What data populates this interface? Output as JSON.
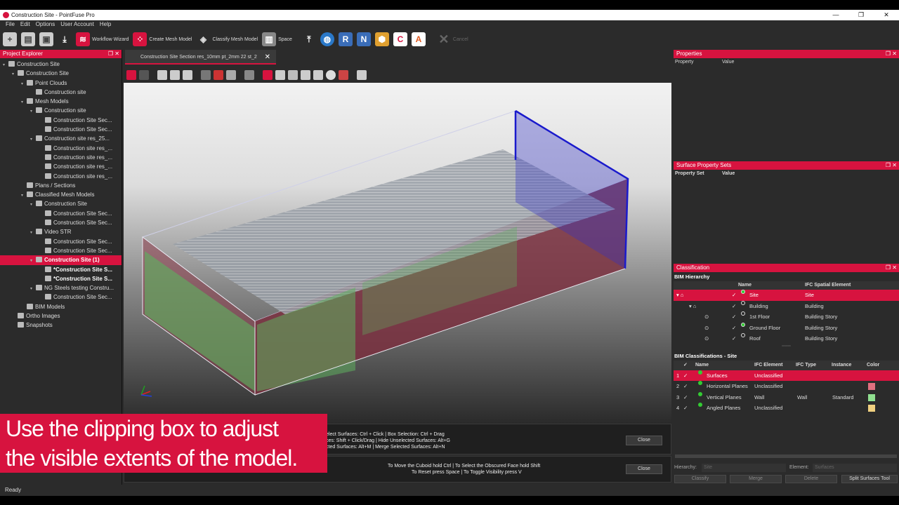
{
  "window": {
    "title": "Construction Site - PointFuse Pro",
    "controls": [
      "—",
      "❐",
      "✕"
    ]
  },
  "menu": [
    "File",
    "Edit",
    "Options",
    "User Account",
    "Help"
  ],
  "toolbar": {
    "workflow_wizard": "Workflow Wizard",
    "create_mesh_model": "Create Mesh Model",
    "classify_mesh_model": "Classify Mesh Model",
    "space": "Space",
    "cancel": "Cancel"
  },
  "explorer": {
    "title": "Project Explorer",
    "items": [
      {
        "label": "Construction Site",
        "depth": 0,
        "arrow": "▾"
      },
      {
        "label": "Construction Site",
        "depth": 1,
        "arrow": "▾"
      },
      {
        "label": "Point Clouds",
        "depth": 2,
        "arrow": "▾"
      },
      {
        "label": "Construction site",
        "depth": 3,
        "arrow": ""
      },
      {
        "label": "Mesh Models",
        "depth": 2,
        "arrow": "▾"
      },
      {
        "label": "Construction site",
        "depth": 3,
        "arrow": "▾"
      },
      {
        "label": "Construction Site Sec...",
        "depth": 4,
        "arrow": ""
      },
      {
        "label": "Construction Site Sec...",
        "depth": 4,
        "arrow": ""
      },
      {
        "label": "Construction site res_25...",
        "depth": 3,
        "arrow": "▾"
      },
      {
        "label": "Construction site res_...",
        "depth": 4,
        "arrow": ""
      },
      {
        "label": "Construction site res_...",
        "depth": 4,
        "arrow": ""
      },
      {
        "label": "Construction site res_...",
        "depth": 4,
        "arrow": ""
      },
      {
        "label": "Construction site res_...",
        "depth": 4,
        "arrow": ""
      },
      {
        "label": "Plans / Sections",
        "depth": 2,
        "arrow": ""
      },
      {
        "label": "Classified Mesh Models",
        "depth": 2,
        "arrow": "▾"
      },
      {
        "label": "Construction Site",
        "depth": 3,
        "arrow": "▾"
      },
      {
        "label": "Construction Site Sec...",
        "depth": 4,
        "arrow": ""
      },
      {
        "label": "Construction Site Sec...",
        "depth": 4,
        "arrow": ""
      },
      {
        "label": "Video STR",
        "depth": 3,
        "arrow": "▾"
      },
      {
        "label": "Construction Site Sec...",
        "depth": 4,
        "arrow": ""
      },
      {
        "label": "Construction Site Sec...",
        "depth": 4,
        "arrow": ""
      },
      {
        "label": "Construction Site (1)",
        "depth": 3,
        "arrow": "▾",
        "selected": true
      },
      {
        "label": "*Construction Site S...",
        "depth": 4,
        "arrow": "",
        "bold": true
      },
      {
        "label": "*Construction Site S...",
        "depth": 4,
        "arrow": "",
        "bold": true
      },
      {
        "label": "NG Steels testing Constru...",
        "depth": 3,
        "arrow": "▾"
      },
      {
        "label": "Construction Site Sec...",
        "depth": 4,
        "arrow": ""
      },
      {
        "label": "BIM Models",
        "depth": 2,
        "arrow": ""
      },
      {
        "label": "Ortho Images",
        "depth": 1,
        "arrow": ""
      },
      {
        "label": "Snapshots",
        "depth": 1,
        "arrow": ""
      }
    ]
  },
  "view_tab": {
    "label": "Construction Site Section res_10mm pt_2mm 22 st_2",
    "close": "✕"
  },
  "messages": {
    "line1": "elect Surfaces: Ctrl + Click | Box Selection: Ctrl + Drag",
    "line2": "ces: Shift + Click/Drag | Hide Unselected Surfaces: Alt+G",
    "line3": "cted Surfaces: Alt+M | Merge Selected Surfaces: Alt+N",
    "cuboid1": "To Move the Cuboid hold Ctrl | To Select the Obscured Face hold Shift",
    "cuboid2": "To Reset press Space | To Toggle Visibility press V",
    "close": "Close"
  },
  "overlay": {
    "line1": "Use the clipping box to adjust",
    "line2": "the visible extents of the model."
  },
  "status": "Ready",
  "properties": {
    "title": "Properties",
    "col1": "Property",
    "col2": "Value"
  },
  "surface_props": {
    "title": "Surface Property Sets",
    "col1": "Property Set",
    "col2": "Value"
  },
  "classification": {
    "title": "Classification",
    "bim_hierarchy": "BIM Hierarchy",
    "hier_cols": [
      "Name",
      "IFC Spatial Element"
    ],
    "hier_rows": [
      {
        "name": "Site",
        "ifc": "Site",
        "selected": true
      },
      {
        "name": "Building",
        "ifc": "Building"
      },
      {
        "name": "1st Floor",
        "ifc": "Building Story"
      },
      {
        "name": "Ground Floor",
        "ifc": "Building Story"
      },
      {
        "name": "Roof",
        "ifc": "Building Story"
      }
    ],
    "bim_classifications": "BIM Classifications - Site",
    "class_cols": [
      "Name",
      "IFC Element",
      "IFC Type",
      "Instance",
      "Color"
    ],
    "class_rows": [
      {
        "num": "1",
        "name": "Surfaces",
        "ifc": "Unclassified",
        "type": "",
        "instance": "",
        "color": "",
        "selected": true
      },
      {
        "num": "2",
        "name": "Horizontal Planes",
        "ifc": "Unclassified",
        "type": "",
        "instance": "",
        "color": "#e07080"
      },
      {
        "num": "3",
        "name": "Vertical Planes",
        "ifc": "Wall",
        "type": "Wall",
        "instance": "Standard",
        "color": "#90e090"
      },
      {
        "num": "4",
        "name": "Angled Planes",
        "ifc": "Unclassified",
        "type": "",
        "instance": "",
        "color": "#f0d080"
      }
    ],
    "hierarchy_label": "Hierarchy:",
    "hierarchy_value": "Site",
    "element_label": "Element:",
    "element_value": "Surfaces",
    "buttons": [
      "Classify",
      "Merge",
      "Delete",
      "Split Surfaces Tool"
    ]
  },
  "colors": {
    "accent": "#d7133f",
    "mesh_green": "#5fae5f",
    "floor_red": "#8a3a48",
    "clip_blue": "#1a1acc"
  }
}
